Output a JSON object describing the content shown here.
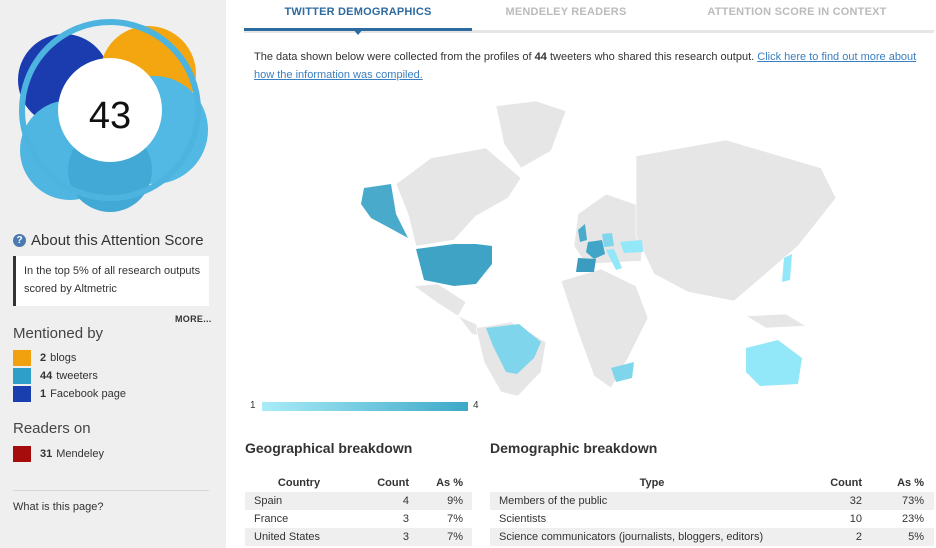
{
  "score": {
    "value": "43"
  },
  "about": {
    "title": "About this Attention Score",
    "icon": "question-circle-icon",
    "callout": "In the top 5% of all research outputs scored by Altmetric",
    "more": "MORE..."
  },
  "mentioned": {
    "title": "Mentioned by",
    "items": [
      {
        "count": "2",
        "label": "blogs",
        "color": "#f1a10d"
      },
      {
        "count": "44",
        "label": "tweeters",
        "color": "#2e9fc9"
      },
      {
        "count": "1",
        "label": "Facebook page",
        "color": "#183fad"
      }
    ]
  },
  "readers": {
    "title": "Readers on",
    "items": [
      {
        "count": "31",
        "label": "Mendeley",
        "color": "#a60c0c"
      }
    ]
  },
  "what_page": "What is this page?",
  "tabs": [
    {
      "label": "TWITTER DEMOGRAPHICS"
    },
    {
      "label": "MENDELEY READERS"
    },
    {
      "label": "ATTENTION SCORE IN CONTEXT"
    }
  ],
  "intro": {
    "prefix": "The data shown below were collected from the profiles of ",
    "count": "44",
    "suffix": " tweeters who shared this research output. ",
    "link": "Click here to find out more about how the information was compiled."
  },
  "legend": {
    "min": "1",
    "max": "4"
  },
  "geo": {
    "title": "Geographical breakdown",
    "headers": [
      "Country",
      "Count",
      "As %"
    ],
    "rows": [
      {
        "country": "Spain",
        "count": "4",
        "pct": "9%"
      },
      {
        "country": "France",
        "count": "3",
        "pct": "7%"
      },
      {
        "country": "United States",
        "count": "3",
        "pct": "7%"
      }
    ]
  },
  "demo": {
    "title": "Demographic breakdown",
    "headers": [
      "Type",
      "Count",
      "As %"
    ],
    "rows": [
      {
        "type": "Members of the public",
        "count": "32",
        "pct": "73%"
      },
      {
        "type": "Scientists",
        "count": "10",
        "pct": "23%"
      },
      {
        "type": "Science communicators (journalists, bloggers, editors)",
        "count": "2",
        "pct": "5%"
      }
    ]
  }
}
